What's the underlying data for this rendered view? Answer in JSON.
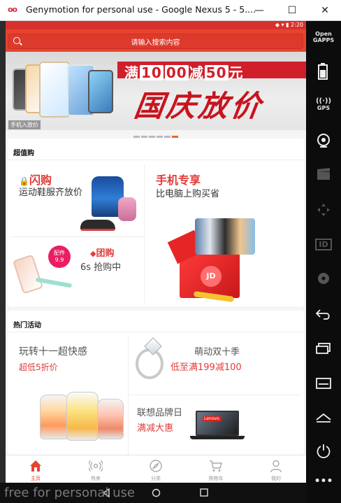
{
  "window": {
    "title": "Genymotion for personal use - Google Nexus 5 - 5....",
    "logo": "oo",
    "minimize": "—",
    "maximize": "☐",
    "close": "✕"
  },
  "statusbar": {
    "time": "2:20"
  },
  "search": {
    "placeholder": "请输入搜索内容"
  },
  "banner": {
    "promo_parts": [
      "满",
      "10",
      "00",
      "减",
      "50",
      "元"
    ],
    "slogan": "国庆放价",
    "tag": "手机入放价"
  },
  "section1": {
    "title": "超值购",
    "flash": {
      "label": "闪购",
      "sub": "运动鞋服齐放价"
    },
    "phone_share": {
      "label": "手机专享",
      "sub": "比电脑上购买省"
    },
    "group": {
      "label": "团购",
      "sub": "6s 抢购中",
      "badge_line1": "配件",
      "badge_line2": "9.9"
    },
    "jd_logo": "JD"
  },
  "section2": {
    "title": "热门活动",
    "double11": {
      "label": "玩转十一超快感",
      "sub": "超低5折价"
    },
    "cute": {
      "label": "萌动双十季",
      "sub": "低至满199减100"
    },
    "lenovo": {
      "label": "联想品牌日",
      "sub": "满减大惠",
      "laptop_brand": "Lenovo"
    }
  },
  "tabs": [
    {
      "label": "主页",
      "icon": "home-icon",
      "active": true
    },
    {
      "label": "热卖",
      "icon": "broadcast-icon",
      "active": false
    },
    {
      "label": "分类",
      "icon": "compass-icon",
      "active": false
    },
    {
      "label": "购物车",
      "icon": "cart-icon",
      "active": false
    },
    {
      "label": "我的",
      "icon": "user-icon",
      "active": false
    }
  ],
  "watermark": "free for personal use",
  "sidebar": {
    "opengapps_line1": "Open",
    "opengapps_line2": "GAPPS",
    "gps": "GPS",
    "id": "ID",
    "more": "•••"
  },
  "colors": {
    "accent": "#e8432f",
    "promo_red": "#d11f2a",
    "text_red": "#e43a3a"
  }
}
